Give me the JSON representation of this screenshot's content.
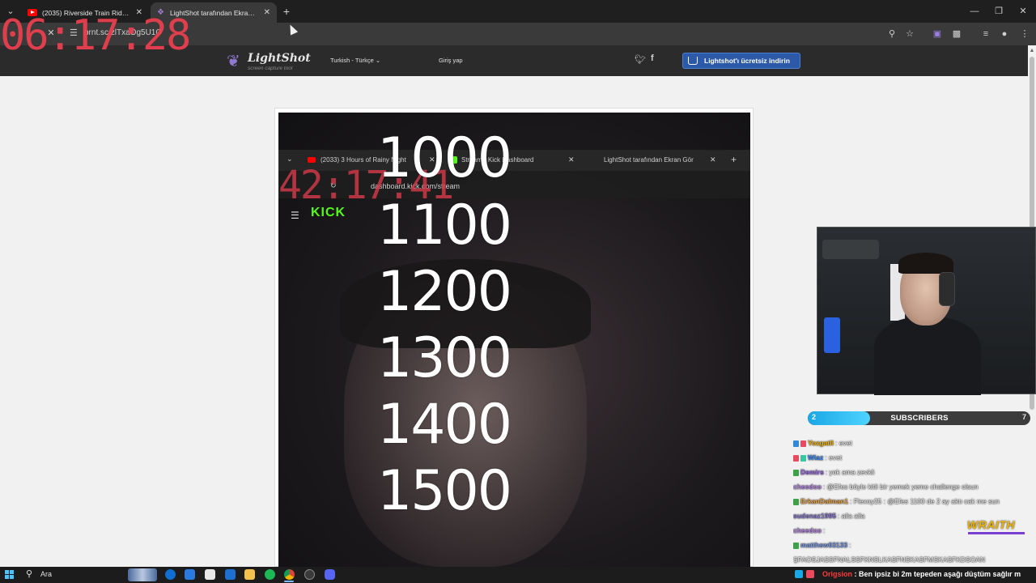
{
  "browser": {
    "tabs": [
      {
        "title": "(2035) Riverside Train Ride in Gr",
        "active": false
      },
      {
        "title": "LightShot tarafından Ekran Görü",
        "active": true
      }
    ],
    "url": "prnt.sc/zlTxaOg5U1O"
  },
  "stream_timer": "06:17:28",
  "lightshot": {
    "logo_text": "LightShot",
    "logo_subtitle": "screen capture tool",
    "language": "Turkish - Türkçe",
    "login": "Giriş yap",
    "download_button": "Lightshot'ı ücretsiz indirin"
  },
  "screenshot": {
    "timer": "42:17:41",
    "inner_tabs": [
      {
        "title": "(2033) 3 Hours of Rainy Night"
      },
      {
        "title": "Stream - Kick Dashboard"
      },
      {
        "title": "LightShot tarafından Ekran Gör"
      }
    ],
    "inner_url": "dashboard.kick.com/stream",
    "kick_logo": "KICK"
  },
  "overlay_numbers": [
    "1000",
    "1100",
    "1200",
    "1300",
    "1400",
    "1500"
  ],
  "subscribers": {
    "label": "SUBSCRIBERS",
    "current": "2",
    "goal": "7",
    "progress": 0.28
  },
  "chat": [
    {
      "name": "Yozgatli",
      "message": ": evet",
      "color": "#f3b400",
      "badges": [
        "#2f8ad8",
        "#e84a5f"
      ]
    },
    {
      "name": "Wiaz",
      "message": ": evet",
      "color": "#3a8cff",
      "badges": [
        "#e84a5f",
        "#36c8a0"
      ]
    },
    {
      "name": "Demirs",
      "message": ": yok ama zevkli",
      "color": "#9a68e8",
      "badges": [
        "#3fa04a"
      ]
    },
    {
      "name": "cheedoo",
      "message": ": @Efes böyle kitli bir yemek yeme challenge olsun",
      "color": "#b98ae8",
      "badges": []
    },
    {
      "name": "ErkanDalman1",
      "message": ": Flexoy25 : @Efes 1100 de 2 ay aktı cak me sun",
      "color": "#e8a040",
      "badges": [
        "#3fa04a"
      ]
    },
    {
      "name": "sudenaz1995",
      "message": ": alla alla",
      "color": "#8a7ad0",
      "badges": []
    },
    {
      "name": "cheedoo",
      "message": ":",
      "color": "#b98ae8",
      "badges": []
    },
    {
      "name": "matthew03133",
      "message": ":",
      "color": "#7a9ae8",
      "badges": [
        "#3fa04a"
      ]
    },
    {
      "name": "",
      "message": "ŞFAOSJASSFNALSSFKNSLKASFNSKASFMSKASFKDSOAN",
      "color": "#ffffff",
      "badges": []
    }
  ],
  "wraith_logo": "WRAITH",
  "taskbar": {
    "search_text": "Ara",
    "ticker_name": "Origsion",
    "ticker_message": ": Ben ipsiz bi 2m tepeden aşağı düştüm sağlır m"
  }
}
